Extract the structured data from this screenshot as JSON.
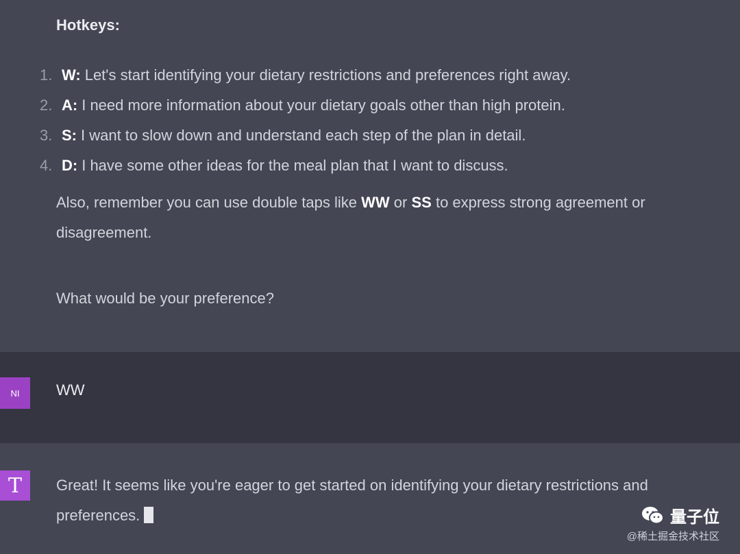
{
  "assistant_top": {
    "heading": "Hotkeys:",
    "hotkeys": [
      {
        "num": "1.",
        "key": "W:",
        "text": "Let's start identifying your dietary restrictions and preferences right away."
      },
      {
        "num": "2.",
        "key": "A:",
        "text": "I need more information about your dietary goals other than high protein."
      },
      {
        "num": "3.",
        "key": "S:",
        "text": "I want to slow down and understand each step of the plan in detail."
      },
      {
        "num": "4.",
        "key": "D:",
        "text": "I have some other ideas for the meal plan that I want to discuss."
      }
    ],
    "also_text_1": "Also, remember you can use double taps like",
    "also_ww": "WW",
    "also_or": "or",
    "also_ss": "SS",
    "also_text_2": "to express strong agreement or disagreement.",
    "question": "What would be your preference?"
  },
  "user": {
    "avatar_label": "NI",
    "message": "WW"
  },
  "assistant_bottom": {
    "avatar_label": "T",
    "message": "Great! It seems like you're eager to get started on identifying your dietary restrictions and preferences."
  },
  "watermark": {
    "brand": "量子位",
    "credit": "@稀土掘金技术社区"
  },
  "colors": {
    "assistant_bg": "#444654",
    "user_bg": "#343541",
    "user_avatar": "#9b42c4",
    "bot_avatar": "#a84fd6"
  },
  "icons": [
    "wechat-logo-icon"
  ]
}
